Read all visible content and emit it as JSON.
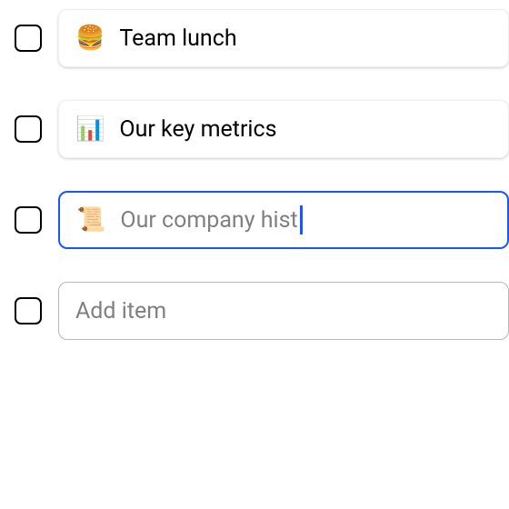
{
  "list": {
    "items": [
      {
        "emoji": "🍔",
        "label": "Team lunch",
        "state": "filled"
      },
      {
        "emoji": "📊",
        "label": "Our key metrics",
        "state": "filled"
      },
      {
        "emoji": "📜",
        "label": "Our company hist",
        "state": "editing"
      }
    ],
    "add_placeholder": "Add item"
  }
}
